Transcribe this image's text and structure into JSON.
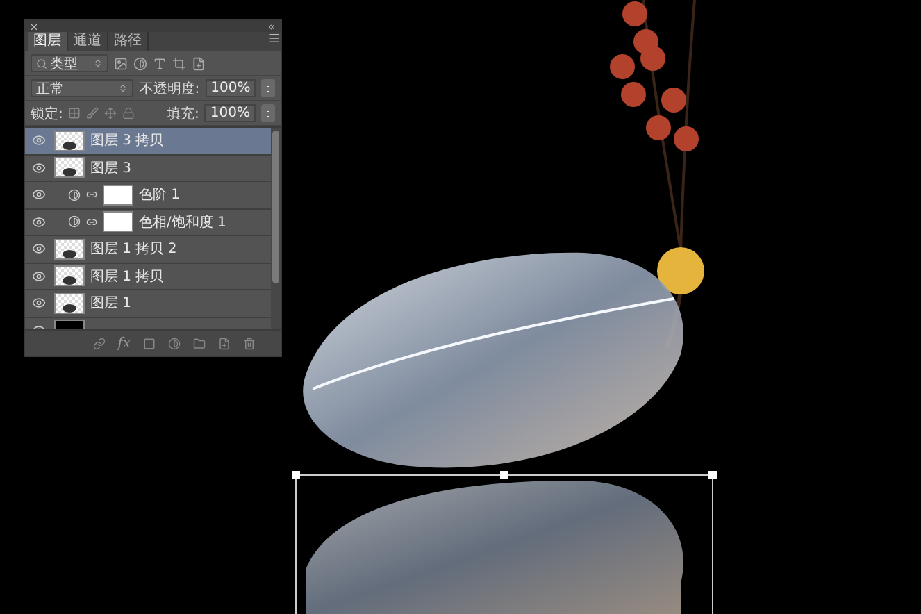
{
  "layers_panel": {
    "tabs": [
      {
        "label": "图层",
        "selected": true
      },
      {
        "label": "通道",
        "selected": false
      },
      {
        "label": "路径",
        "selected": false
      }
    ],
    "filter": {
      "value": "类型"
    },
    "blend_mode": {
      "value": "正常"
    },
    "opacity": {
      "label": "不透明度:",
      "value": "100%"
    },
    "lock": {
      "label": "锁定:"
    },
    "fill": {
      "label": "填充:",
      "value": "100%"
    },
    "layers": [
      {
        "name": "图层 3 拷贝",
        "kind": "pixel",
        "visible": true,
        "selected": true
      },
      {
        "name": "图层 3",
        "kind": "pixel",
        "visible": true,
        "selected": false
      },
      {
        "name": "色阶 1",
        "kind": "adjustment",
        "visible": true,
        "selected": false
      },
      {
        "name": "色相/饱和度 1",
        "kind": "adjustment",
        "visible": true,
        "selected": false
      },
      {
        "name": "图层 1 拷贝 2",
        "kind": "pixel",
        "visible": true,
        "selected": false
      },
      {
        "name": "图层 1 拷贝",
        "kind": "pixel",
        "visible": true,
        "selected": false
      },
      {
        "name": "图层 1",
        "kind": "pixel",
        "visible": true,
        "selected": false
      },
      {
        "kind": "solid",
        "visible": true,
        "selected": false
      }
    ],
    "footer": {
      "effects_label": "fx"
    }
  }
}
